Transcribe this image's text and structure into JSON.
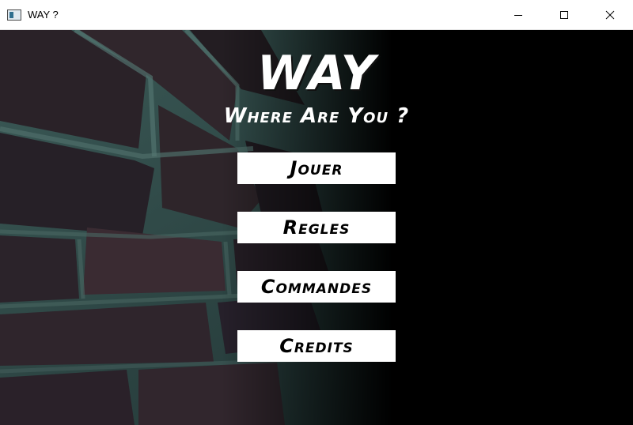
{
  "window": {
    "title": "WAY ?",
    "icon": "app-window-icon",
    "controls": [
      "minimize-icon",
      "maximize-icon",
      "close-icon"
    ]
  },
  "main": {
    "title": "WAY",
    "subtitle": "Where Are You ?",
    "menu": [
      {
        "label": "Jouer"
      },
      {
        "label": "Regles"
      },
      {
        "label": "Commandes"
      },
      {
        "label": "Credits"
      }
    ]
  },
  "colors": {
    "background": "#000000",
    "button": "#ffffff",
    "text_light": "#ffffff",
    "text_dark": "#000000"
  }
}
